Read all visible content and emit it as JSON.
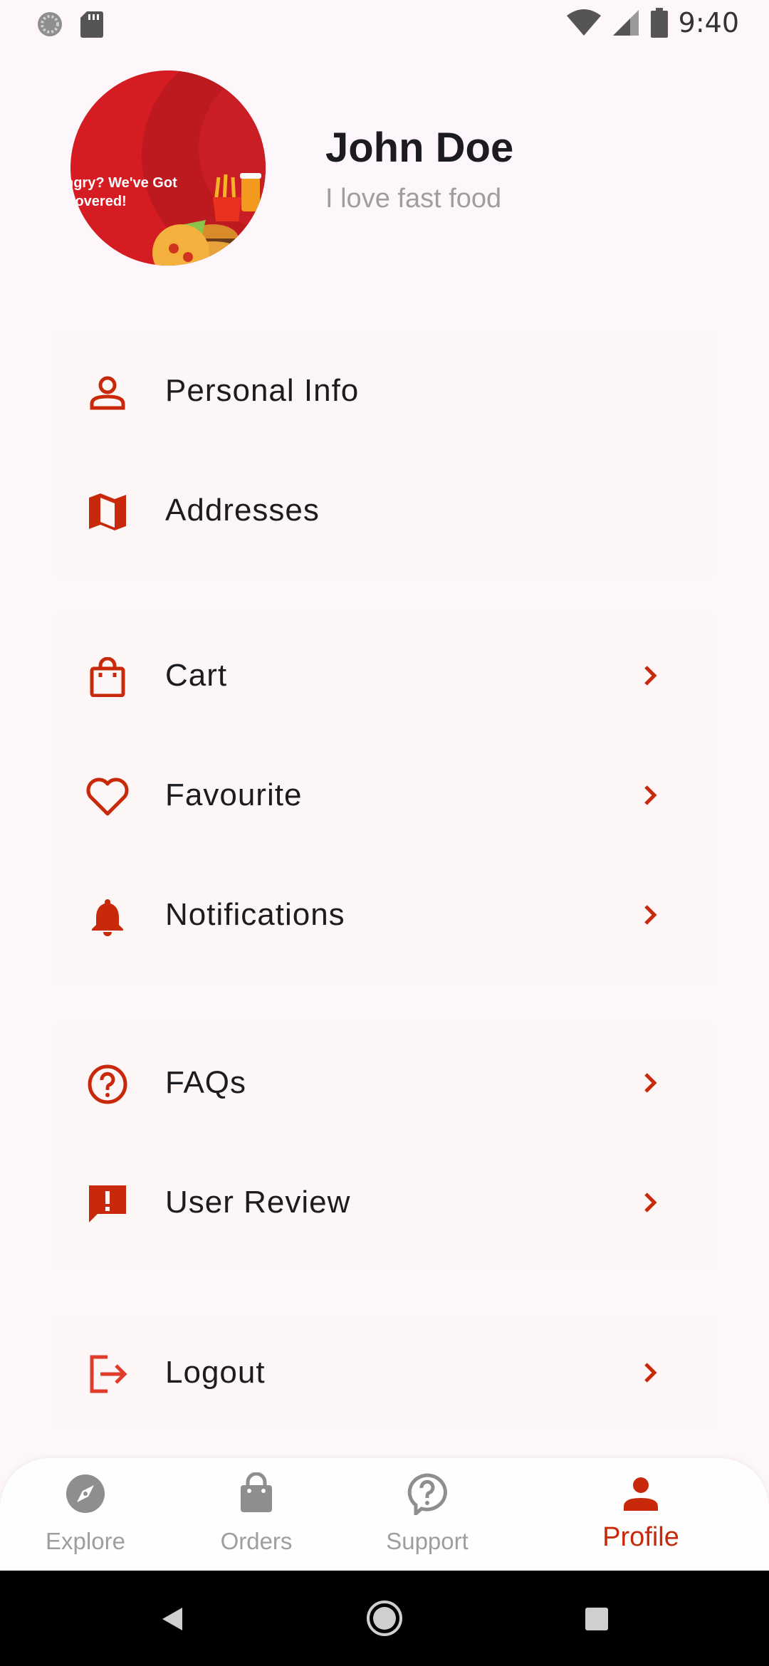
{
  "status_bar": {
    "time": "9:40"
  },
  "profile": {
    "avatar_text": "ngry? We've Got Covered!",
    "name": "John Doe",
    "tagline": "I love fast food"
  },
  "menu": {
    "personal_info": "Personal Info",
    "addresses": "Addresses",
    "cart": "Cart",
    "favourite": "Favourite",
    "notifications": "Notifications",
    "faqs": "FAQs",
    "user_review": "User Review",
    "logout": "Logout"
  },
  "bottom_nav": {
    "explore": "Explore",
    "orders": "Orders",
    "support": "Support",
    "profile": "Profile",
    "active": "Profile"
  },
  "colors": {
    "accent": "#c8290b",
    "inactive": "#9e9e9e",
    "card_bg": "#fdf6f6"
  }
}
